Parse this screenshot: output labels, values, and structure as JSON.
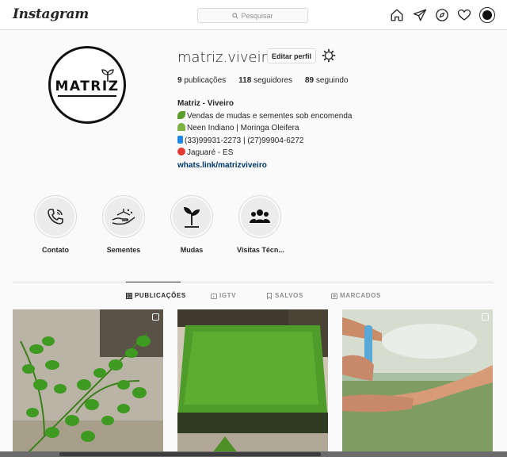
{
  "header": {
    "logo": "Instagram",
    "search_placeholder": "Pesquisar"
  },
  "profile": {
    "username": "matriz.viveiro",
    "edit_label": "Editar perfil",
    "avatar_text": "MATRIZ",
    "stats": [
      {
        "count": "9",
        "label": "publicações"
      },
      {
        "count": "118",
        "label": "seguidores"
      },
      {
        "count": "89",
        "label": "seguindo"
      }
    ],
    "bio": {
      "name": "Matriz - Viveiro",
      "line1": "Vendas de mudas e sementes sob encomenda",
      "line2": "Neen Indiano | Moringa Oleifera",
      "line3": "(33)99931-2273 | (27)99904-6272",
      "line4": "Jaguaré - ES",
      "link": "whats.link/matrizviveiro"
    }
  },
  "highlights": [
    {
      "label": "Contato"
    },
    {
      "label": "Sementes"
    },
    {
      "label": "Mudas"
    },
    {
      "label": "Visitas Técn..."
    }
  ],
  "tabs": [
    {
      "label": "PUBLICAÇÕES",
      "active": true
    },
    {
      "label": "IGTV",
      "active": false
    },
    {
      "label": "SALVOS",
      "active": false
    },
    {
      "label": "MARCADOS",
      "active": false
    }
  ],
  "colors": {
    "link": "#00376b",
    "border": "#dbdbdb",
    "muted": "#8e8e8e",
    "text": "#262626"
  }
}
